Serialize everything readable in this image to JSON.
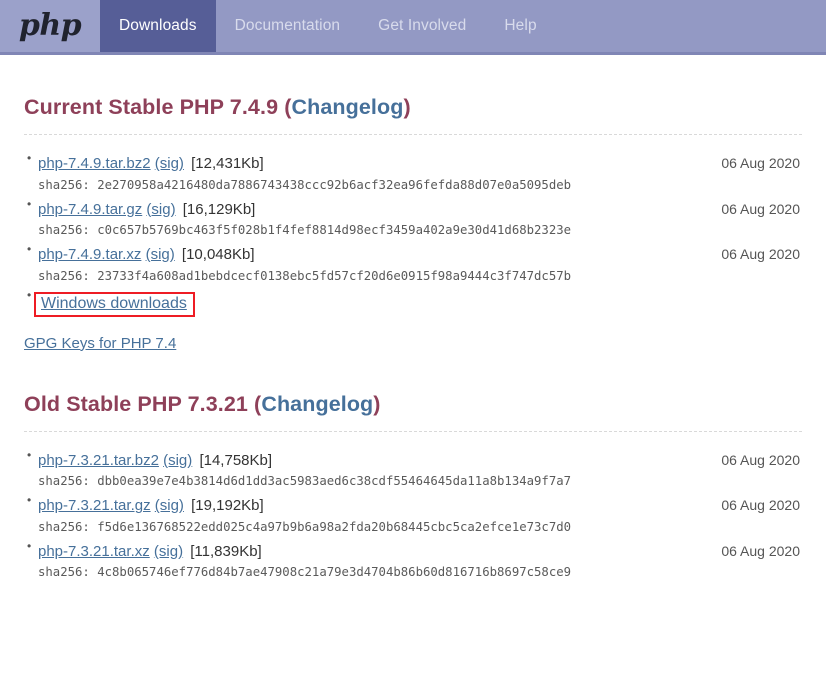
{
  "nav": {
    "logo": "php",
    "items": [
      {
        "label": "Downloads",
        "active": true
      },
      {
        "label": "Documentation",
        "active": false
      },
      {
        "label": "Get Involved",
        "active": false
      },
      {
        "label": "Help",
        "active": false
      }
    ]
  },
  "sections": [
    {
      "title_prefix": "Current Stable PHP 7.4.9 ",
      "paren_open": "(",
      "changelog_label": "Changelog",
      "paren_close": ")",
      "downloads": [
        {
          "name": "php-7.4.9.tar.bz2",
          "sig_label": "(sig)",
          "size": "[12,431Kb]",
          "date": "06 Aug 2020",
          "sha256": "sha256: 2e270958a4216480da7886743438ccc92b6acf32ea96fefda88d07e0a5095deb"
        },
        {
          "name": "php-7.4.9.tar.gz",
          "sig_label": "(sig)",
          "size": "[16,129Kb]",
          "date": "06 Aug 2020",
          "sha256": "sha256: c0c657b5769bc463f5f028b1f4fef8814d98ecf3459a402a9e30d41d68b2323e"
        },
        {
          "name": "php-7.4.9.tar.xz",
          "sig_label": "(sig)",
          "size": "[10,048Kb]",
          "date": "06 Aug 2020",
          "sha256": "sha256: 23733f4a608ad1bebdcecf0138ebc5fd57cf20d6e0915f98a9444c3f747dc57b"
        }
      ],
      "windows_link": "Windows downloads",
      "gpg_link": "GPG Keys for PHP 7.4"
    },
    {
      "title_prefix": "Old Stable PHP 7.3.21 ",
      "paren_open": "(",
      "changelog_label": "Changelog",
      "paren_close": ")",
      "downloads": [
        {
          "name": "php-7.3.21.tar.bz2",
          "sig_label": "(sig)",
          "size": "[14,758Kb]",
          "date": "06 Aug 2020",
          "sha256": "sha256: dbb0ea39e7e4b3814d6d1dd3ac5983aed6c38cdf55464645da11a8b134a9f7a7"
        },
        {
          "name": "php-7.3.21.tar.gz",
          "sig_label": "(sig)",
          "size": "[19,192Kb]",
          "date": "06 Aug 2020",
          "sha256": "sha256: f5d6e136768522edd025c4a97b9b6a98a2fda20b68445cbc5ca2efce1e73c7d0"
        },
        {
          "name": "php-7.3.21.tar.xz",
          "sig_label": "(sig)",
          "size": "[11,839Kb]",
          "date": "06 Aug 2020",
          "sha256": "sha256: 4c8b065746ef776d84b7ae47908c21a79e3d4704b86b60d816716b8697c58ce9"
        }
      ]
    }
  ],
  "colors": {
    "nav_bg": "#9399c4",
    "nav_active": "#565e97",
    "heading": "#8e4059",
    "link": "#46709a",
    "annotation": "#ee1c24"
  }
}
